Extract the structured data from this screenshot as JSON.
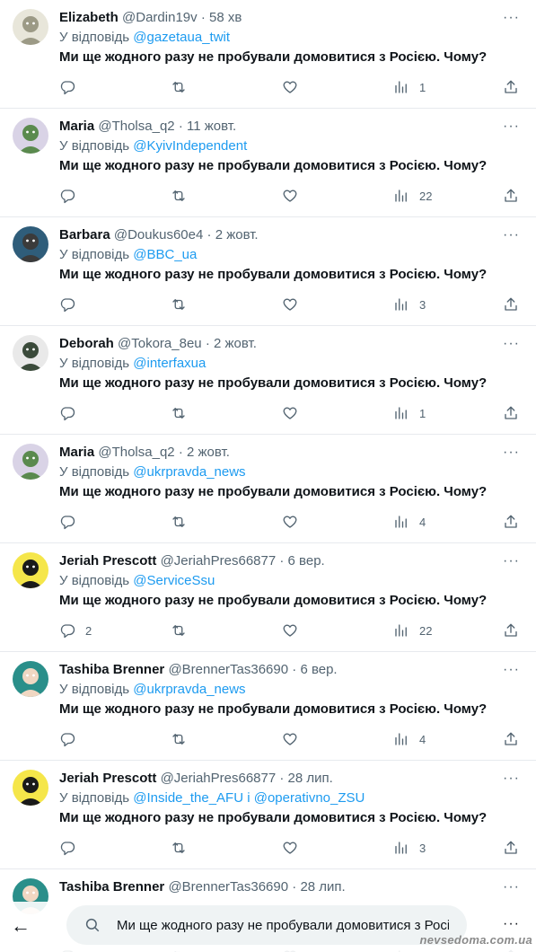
{
  "tweets": [
    {
      "name": "Elizabeth",
      "handle": "@Dardin19v",
      "dot": "·",
      "time": "58 хв",
      "reply_prefix": "У відповідь",
      "reply_to": "@gazetaua_twit",
      "text": "Ми ще жодного разу не пробували домовитися з Росією. Чому?",
      "replies": "",
      "views": "1",
      "avatar_bg": "#e8e6da",
      "avatar_fg": "#9c9a86"
    },
    {
      "name": "Maria",
      "handle": "@Tholsa_q2",
      "dot": "·",
      "time": "11 жовт.",
      "reply_prefix": "У відповідь",
      "reply_to": "@KyivIndependent",
      "text": "Ми ще жодного разу не пробували домовитися з Росією. Чому?",
      "replies": "",
      "views": "22",
      "avatar_bg": "#d9d3e6",
      "avatar_fg": "#5a8a4e"
    },
    {
      "name": "Barbara",
      "handle": "@Doukus60e4",
      "dot": "·",
      "time": "2 жовт.",
      "reply_prefix": "У відповідь",
      "reply_to": "@BBC_ua",
      "text": "Ми ще жодного разу не пробували домовитися з Росією. Чому?",
      "replies": "",
      "views": "3",
      "avatar_bg": "#2f5d7a",
      "avatar_fg": "#3b3b3b"
    },
    {
      "name": "Deborah",
      "handle": "@Tokora_8eu",
      "dot": "·",
      "time": "2 жовт.",
      "reply_prefix": "У відповідь",
      "reply_to": "@interfaxua",
      "text": "Ми ще жодного разу не пробували домовитися з Росією. Чому?",
      "replies": "",
      "views": "1",
      "avatar_bg": "#e9e9e9",
      "avatar_fg": "#3a4a3a"
    },
    {
      "name": "Maria",
      "handle": "@Tholsa_q2",
      "dot": "·",
      "time": "2 жовт.",
      "reply_prefix": "У відповідь",
      "reply_to": "@ukrpravda_news",
      "text": "Ми ще жодного разу не пробували домовитися з Росією. Чому?",
      "replies": "",
      "views": "4",
      "avatar_bg": "#d9d3e6",
      "avatar_fg": "#5a8a4e"
    },
    {
      "name": "Jeriah Prescott",
      "handle": "@JeriahPres66877",
      "dot": "·",
      "time": "6 вер.",
      "reply_prefix": "У відповідь",
      "reply_to": "@ServiceSsu",
      "text": "Ми ще жодного разу не пробували домовитися з Росією. Чому?",
      "replies": "2",
      "views": "22",
      "avatar_bg": "#f5e64a",
      "avatar_fg": "#1a1a1a"
    },
    {
      "name": "Tashiba Brenner",
      "handle": "@BrennerTas36690",
      "dot": "·",
      "time": "6 вер.",
      "reply_prefix": "У відповідь",
      "reply_to": "@ukrpravda_news",
      "text": "Ми ще жодного разу не пробували домовитися з Росією. Чому?",
      "replies": "",
      "views": "4",
      "avatar_bg": "#2a8f8a",
      "avatar_fg": "#f0d7c2"
    },
    {
      "name": "Jeriah Prescott",
      "handle": "@JeriahPres66877",
      "dot": "·",
      "time": "28 лип.",
      "reply_prefix": "У відповідь",
      "reply_to": "@Inside_the_AFU і @operativno_ZSU",
      "text": "Ми ще жодного разу не пробували домовитися з Росією. Чому?",
      "replies": "",
      "views": "3",
      "avatar_bg": "#f5e64a",
      "avatar_fg": "#1a1a1a"
    },
    {
      "name": "Tashiba Brenner",
      "handle": "@BrennerTas36690",
      "dot": "·",
      "time": "28 лип.",
      "reply_prefix": "",
      "reply_to": "",
      "text": "",
      "replies": "",
      "views": "",
      "avatar_bg": "#2a8f8a",
      "avatar_fg": "#f0d7c2"
    }
  ],
  "more_glyph": "···",
  "bottom": {
    "back_glyph": "←",
    "search_value": "Ми ще жодного разу не пробували домовитися з Росіє",
    "more_glyph": "···"
  },
  "watermark": "nevsedoma.com.ua",
  "icons": [
    "reply-icon",
    "retweet-icon",
    "like-icon",
    "views-icon",
    "share-icon",
    "search-icon",
    "back-arrow-icon",
    "more-icon"
  ],
  "colors": {
    "link": "#1d9bf0",
    "muted": "#536471",
    "text": "#0f1419",
    "divider": "#e7eaee"
  }
}
